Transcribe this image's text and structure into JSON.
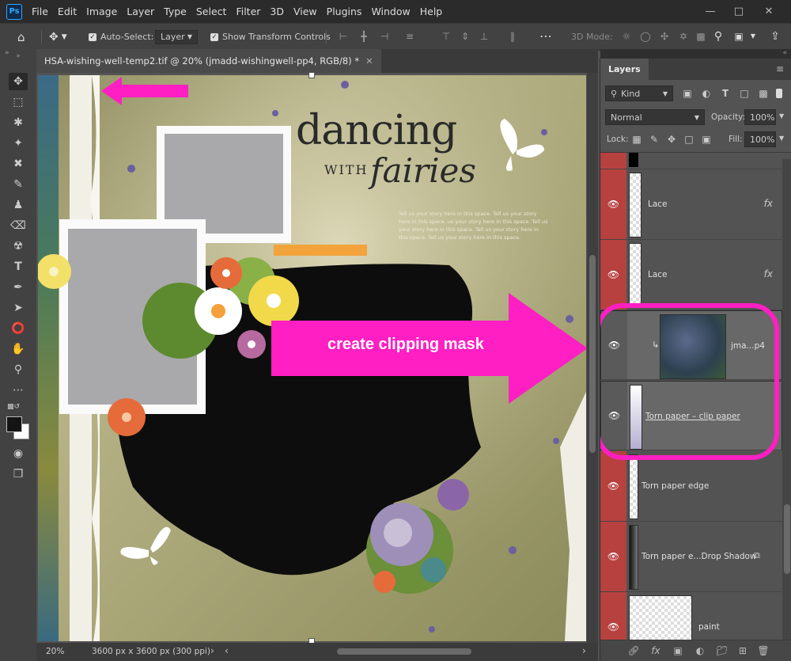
{
  "app": {
    "logo": "Ps"
  },
  "menu": [
    "File",
    "Edit",
    "Image",
    "Layer",
    "Type",
    "Select",
    "Filter",
    "3D",
    "View",
    "Plugins",
    "Window",
    "Help"
  ],
  "options": {
    "auto_select_label": "Auto-Select:",
    "auto_select_value": "Layer",
    "show_transform_label": "Show Transform Controls",
    "mode_3d_label": "3D Mode:"
  },
  "document": {
    "tab_title": "HSA-wishing-well-temp2.tif @ 20% (jmadd-wishingwell-pp4, RGB/8) *",
    "zoom": "20%",
    "size_info": "3600 px x 3600 px (300 ppi)"
  },
  "artwork": {
    "title_line1": "dancing",
    "title_with": "WITH",
    "title_line2": "fairies",
    "journal_text": "Tell us your story here in this space. Tell us your story here in this space. us your story here in this space. Tell us your story here in this space. Tell us your story here in this space. Tell us your story here in this space.",
    "callout_text": "create clipping mask",
    "accent_color": "#ff1fc2"
  },
  "layers_panel": {
    "tab": "Layers",
    "filter_kind": "Kind",
    "blend_mode": "Normal",
    "opacity_label": "Opacity:",
    "opacity_value": "100%",
    "lock_label": "Lock:",
    "fill_label": "Fill:",
    "fill_value": "100%",
    "layers": [
      {
        "name": "Lace",
        "fx": "fx"
      },
      {
        "name": "Lace",
        "fx": "fx"
      },
      {
        "name": "jma...p4"
      },
      {
        "name": "Torn paper – clip paper"
      },
      {
        "name": "Torn paper edge"
      },
      {
        "name": "Torn paper e...Drop Shadow"
      },
      {
        "name": "paint"
      }
    ]
  },
  "icons": {
    "visibility": "eye-icon",
    "link": "link-icon",
    "fx": "fx-icon",
    "mask": "mask-icon",
    "adjustment": "adjustment-icon",
    "group": "folder-icon",
    "new": "new-layer-icon",
    "delete": "trash-icon"
  }
}
